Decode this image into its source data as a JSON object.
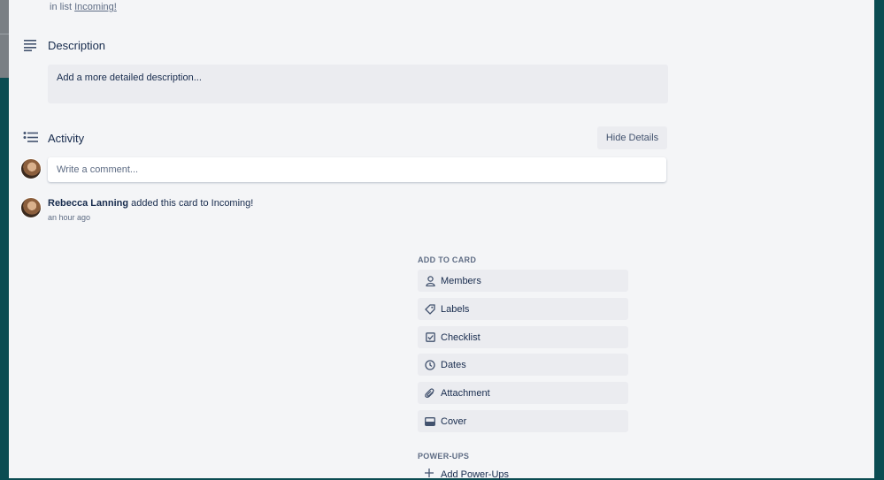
{
  "card": {
    "in_list_prefix": "in list",
    "list_name": "Incoming!"
  },
  "description": {
    "title": "Description",
    "placeholder": "Add a more detailed description..."
  },
  "activity": {
    "title": "Activity",
    "hide_details_label": "Hide Details",
    "comment_placeholder": "Write a comment...",
    "entries": [
      {
        "user": "Rebecca Lanning",
        "action": "added this card to Incoming!",
        "time": "an hour ago"
      }
    ]
  },
  "sidebar": {
    "add_to_card_heading": "ADD TO CARD",
    "buttons": [
      {
        "label": "Members",
        "icon": "person-icon"
      },
      {
        "label": "Labels",
        "icon": "tag-icon"
      },
      {
        "label": "Checklist",
        "icon": "checkbox-icon"
      },
      {
        "label": "Dates",
        "icon": "clock-icon"
      },
      {
        "label": "Attachment",
        "icon": "paperclip-icon"
      },
      {
        "label": "Cover",
        "icon": "cover-icon"
      }
    ],
    "power_ups_heading": "POWER-UPS",
    "add_power_ups_label": "Add Power-Ups"
  }
}
